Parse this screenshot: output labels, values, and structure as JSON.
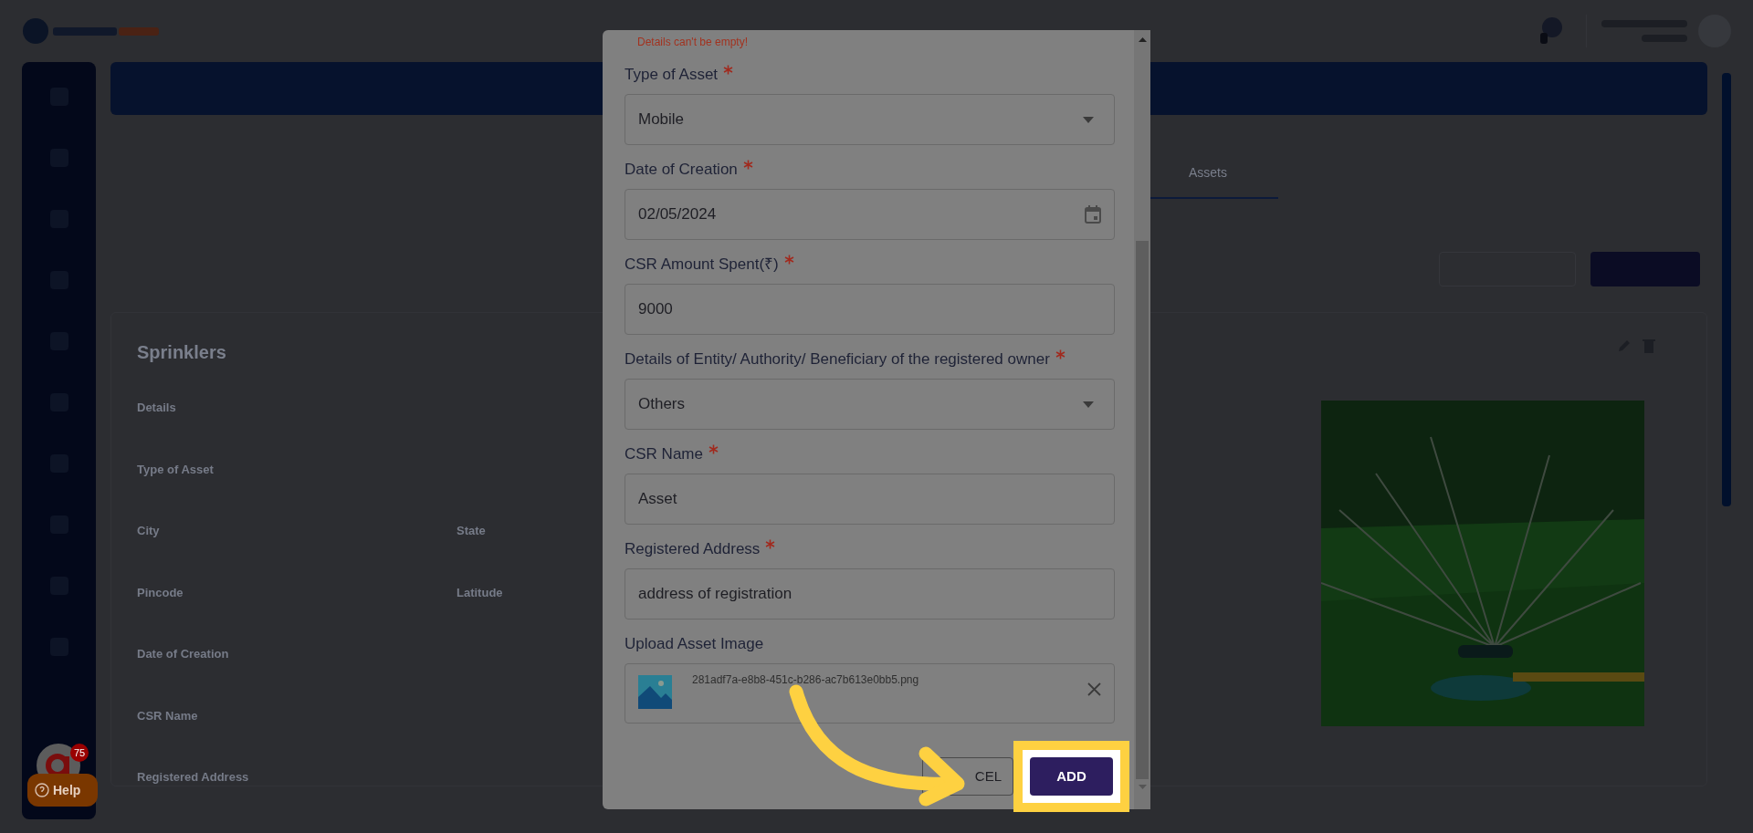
{
  "background": {
    "active_tab": {
      "label": "Assets",
      "selected": true
    },
    "card": {
      "title": "Sprinklers",
      "label_rows": [
        [
          {
            "text": "Details"
          }
        ],
        [
          {
            "text": "Type of Asset"
          }
        ],
        [
          {
            "text": "City"
          },
          {
            "text": "State"
          }
        ],
        [
          {
            "text": "Pincode"
          },
          {
            "text": "Latitude"
          }
        ],
        [
          {
            "text": "Date of Creation"
          }
        ],
        [
          {
            "text": "CSR Name"
          }
        ],
        [
          {
            "text": "Registered Address"
          }
        ]
      ],
      "image": {
        "kind": "picture"
      }
    },
    "help": {
      "label": "Help",
      "badge": "75"
    }
  },
  "modal": {
    "error": "Details can't be empty!",
    "fields": [
      {
        "label": "Type of Asset",
        "required": true,
        "kind": "select",
        "value": "Mobile"
      },
      {
        "label": "Date of Creation",
        "required": true,
        "kind": "date",
        "value": "02/05/2024"
      },
      {
        "label": "CSR Amount Spent(₹)",
        "required": true,
        "kind": "text",
        "value": "9000"
      },
      {
        "label": "Details of Entity/ Authority/ Beneficiary of the registered owner",
        "required": true,
        "kind": "select",
        "value": "Others"
      },
      {
        "label": "CSR Name",
        "required": true,
        "kind": "text",
        "value": "Asset"
      },
      {
        "label": "Registered Address",
        "required": true,
        "kind": "text",
        "value": "address of registration"
      }
    ],
    "upload": {
      "label": "Upload Asset Image",
      "required": false,
      "file_name": "281adf7a-e8b8-451c-b286-ac7b613e0bb5.png"
    },
    "buttons": [
      {
        "label": "CEL",
        "kind": "outline"
      },
      {
        "label": "ADD",
        "kind": "primary",
        "highlighted": true
      }
    ]
  }
}
